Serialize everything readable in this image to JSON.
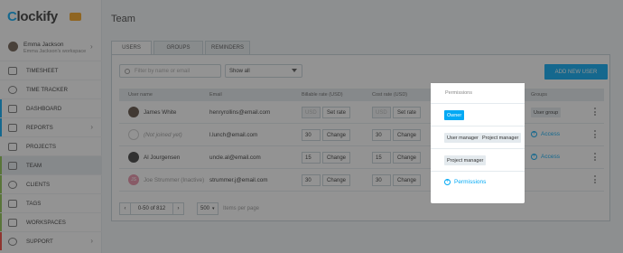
{
  "app": {
    "logo_text": "lockify",
    "logo_letter": "C"
  },
  "user": {
    "name": "Emma Jackson",
    "workspace": "Emma Jackson's workspace"
  },
  "nav": {
    "items": [
      {
        "label": "TIMESHEET",
        "icon": "timesheet-icon",
        "stripe": ""
      },
      {
        "label": "TIME TRACKER",
        "icon": "clock-icon",
        "stripe": ""
      },
      {
        "label": "DASHBOARD",
        "icon": "dashboard-icon",
        "stripe": "#03a9f4"
      },
      {
        "label": "REPORTS",
        "icon": "reports-icon",
        "stripe": "#03a9f4"
      },
      {
        "label": "PROJECTS",
        "icon": "projects-icon",
        "stripe": ""
      },
      {
        "label": "TEAM",
        "icon": "team-icon",
        "stripe": "#8bc34a"
      },
      {
        "label": "CLIENTS",
        "icon": "clients-icon",
        "stripe": "#8bc34a"
      },
      {
        "label": "TAGS",
        "icon": "tag-icon",
        "stripe": "#8bc34a"
      },
      {
        "label": "WORKSPACES",
        "icon": "workspaces-icon",
        "stripe": "#8bc34a"
      },
      {
        "label": "SUPPORT",
        "icon": "support-icon",
        "stripe": "#f44336"
      }
    ]
  },
  "page": {
    "title": "Team"
  },
  "tabs": [
    {
      "label": "USERS"
    },
    {
      "label": "GROUPS"
    },
    {
      "label": "REMINDERS"
    }
  ],
  "filters": {
    "search_placeholder": "Filter by name or email",
    "show_value": "Show all"
  },
  "add_user_label": "ADD NEW USER",
  "table": {
    "headers": {
      "name": "User name",
      "email": "Email",
      "billable": "Billable rate (USD)",
      "cost": "Cost rate (USD)",
      "permissions": "Permissions",
      "groups": "Groups"
    },
    "rows": [
      {
        "name": "James White",
        "email": "henryrollins@email.com",
        "billable": "USD",
        "billable_btn": "Set rate",
        "cost": "USD",
        "cost_btn": "Set rate",
        "perm": [
          "Owner"
        ],
        "group": "User group"
      },
      {
        "name": "(Not joined yet)",
        "email": "l.lunch@email.com",
        "billable": "30",
        "billable_btn": "Change",
        "cost": "30",
        "cost_btn": "Change",
        "perm": [
          "User manager",
          "Project manager"
        ],
        "access": "Access"
      },
      {
        "name": "Al Jourgensen",
        "email": "uncle.al@email.com",
        "billable": "15",
        "billable_btn": "Change",
        "cost": "15",
        "cost_btn": "Change",
        "perm": [
          "Project manager"
        ],
        "access": "Access"
      },
      {
        "name": "Joe Strummer (Inactive)",
        "email": "strummer.j@email.com",
        "billable": "30",
        "billable_btn": "Change",
        "cost": "30",
        "cost_btn": "Change",
        "perm_link": "Permissions"
      }
    ]
  },
  "pagination": {
    "range": "0-50 of 812",
    "per_page": "500",
    "per_page_label": "Items per page"
  },
  "colors": {
    "accent": "#03a9f4",
    "overlay": "rgba(40,40,40,0.5)"
  }
}
